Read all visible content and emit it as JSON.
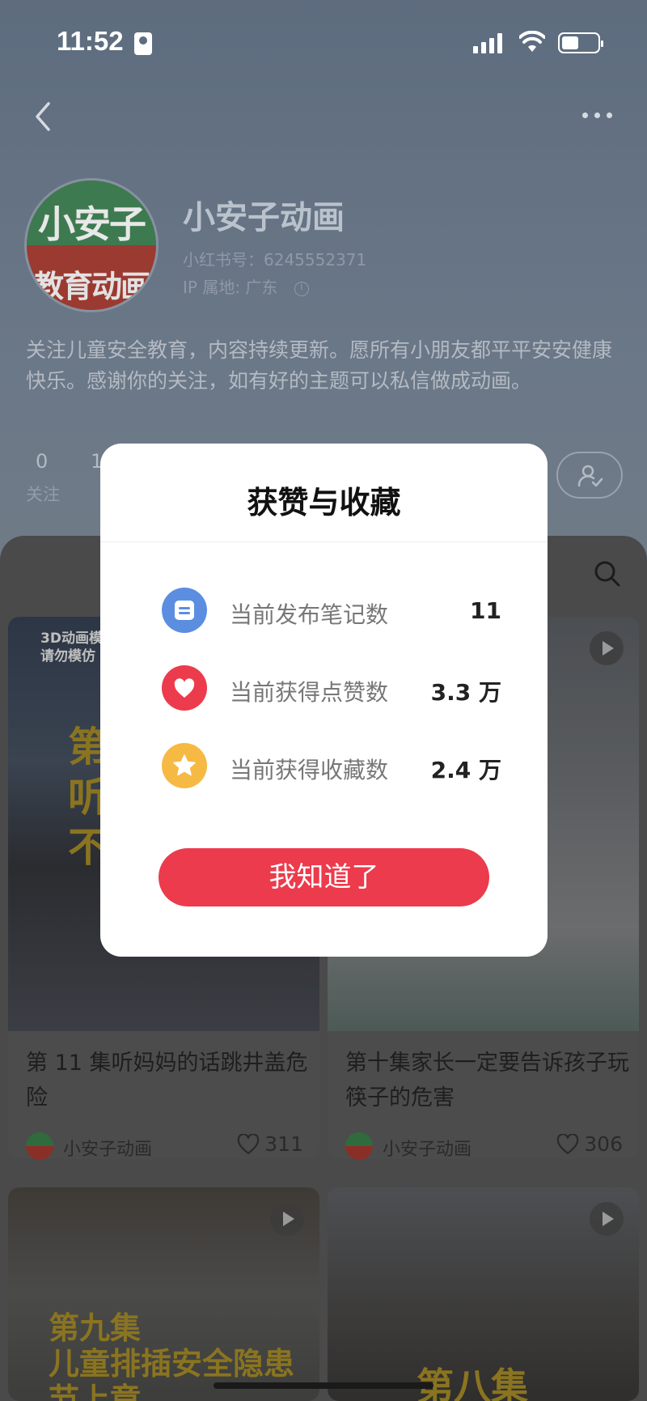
{
  "status_bar": {
    "time": "11:52"
  },
  "profile": {
    "avatar_line1": "小安子",
    "avatar_line2": "教育动画",
    "name": "小安子动画",
    "id_text": "小红书号：6245552371",
    "ip_text": "IP 属地: 广东",
    "bio": "关注儿童安全教育，内容持续更新。愿所有小朋友都平平安安健康快乐。感谢你的关注，如有好的主题可以私信做成动画。"
  },
  "stats": {
    "follow_count": "0",
    "follow_label": "关注",
    "partial_count": "1"
  },
  "cards": [
    {
      "title": "第 11 集听妈妈的话跳井盖危险",
      "author": "小安子动画",
      "likes": "311",
      "overlay_small": "3D动画模\n请勿模仿",
      "overlay_big": "第\n听\n不"
    },
    {
      "title": "第十集家长一定要告诉孩子玩筷子的危害",
      "author": "小安子动画",
      "likes": "306"
    },
    {
      "overlay_big": "第九集\n儿童排插安全隐患\n节上章"
    },
    {
      "overlay_big": "第八集"
    }
  ],
  "modal": {
    "title": "获赞与收藏",
    "rows": [
      {
        "label": "当前发布笔记数",
        "value": "11",
        "icon": "note-icon",
        "color": "#5b8ee0"
      },
      {
        "label": "当前获得点赞数",
        "value": "3.3 万",
        "icon": "heart-icon",
        "color": "#ec3b4c"
      },
      {
        "label": "当前获得收藏数",
        "value": "2.4 万",
        "icon": "star-icon",
        "color": "#f6b943"
      }
    ],
    "button_label": "我知道了"
  }
}
